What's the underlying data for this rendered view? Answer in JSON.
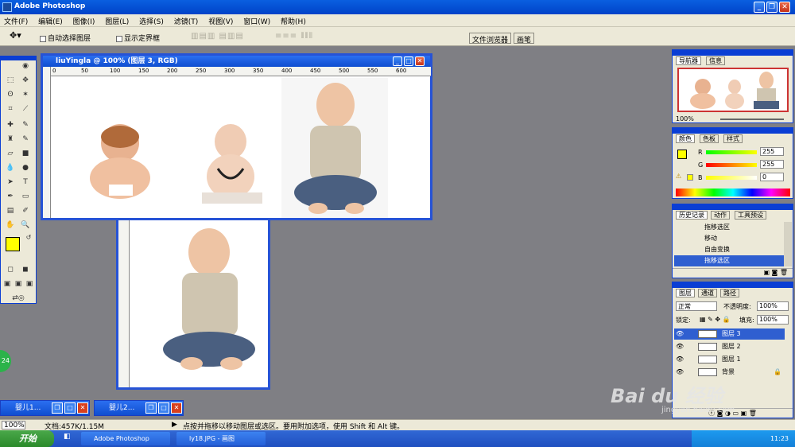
{
  "app": {
    "title": "Adobe Photoshop"
  },
  "menu": [
    "文件(F)",
    "编辑(E)",
    "图像(I)",
    "图层(L)",
    "选择(S)",
    "滤镜(T)",
    "视图(V)",
    "窗口(W)",
    "帮助(H)"
  ],
  "options": {
    "auto_select_layer": "自动选择图层",
    "show_bounding_box": "显示定界框",
    "file_browser": "文件浏览器",
    "brushes": "画笔"
  },
  "doc_main": {
    "title": "liuYingla @ 100% (图层 3, RGB)",
    "ruler_marks": [
      "0",
      "50",
      "100",
      "150",
      "200",
      "250",
      "300",
      "350",
      "400",
      "450",
      "500",
      "550",
      "600"
    ]
  },
  "minimized": [
    {
      "label": "婴儿1..."
    },
    {
      "label": "婴儿2..."
    }
  ],
  "badge": "24",
  "navigator": {
    "tab1": "导航器",
    "tab2": "信息",
    "zoom": "100%"
  },
  "color_panel": {
    "tab1": "颜色",
    "tab2": "色板",
    "tab3": "样式",
    "r_label": "R",
    "g_label": "G",
    "b_label": "B",
    "r": "255",
    "g": "255",
    "b": "0"
  },
  "history": {
    "tab1": "历史记录",
    "tab2": "动作",
    "tab3": "工具预设",
    "items": [
      "拖移选区",
      "移动",
      "自由变换",
      "拖移选区"
    ]
  },
  "layers": {
    "tab1": "图层",
    "tab2": "通道",
    "tab3": "路径",
    "blend": "正常",
    "opacity_label": "不透明度:",
    "opacity": "100%",
    "lock_label": "锁定:",
    "fill_label": "填充:",
    "fill": "100%",
    "items": [
      "图层 3",
      "图层 2",
      "图层 1",
      "背景"
    ]
  },
  "status": {
    "zoom": "100%",
    "doc": "文档:457K/1.15M",
    "hint": "点按并拖移以移动图层或选区。要用附加选项，使用 Shift 和 Alt 键。"
  },
  "taskbar": {
    "start": "开始",
    "items": [
      "Adobe Photoshop",
      "ly18.JPG - 画图"
    ],
    "time": "11:23"
  },
  "watermark": {
    "brand": "Bai du 经验",
    "url": "jingyan.baidu.com"
  },
  "colors": {
    "foreground": "#ffff00",
    "background": "#22cc22",
    "title_blue": "#0a3ed4"
  }
}
